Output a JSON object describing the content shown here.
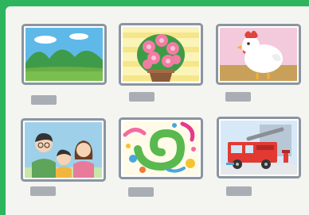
{
  "gallery": {
    "items": [
      {
        "icon": "mountain-landscape-icon",
        "label": ""
      },
      {
        "icon": "potted-flower-icon",
        "label": ""
      },
      {
        "icon": "chicken-icon",
        "label": ""
      },
      {
        "icon": "family-portrait-icon",
        "label": ""
      },
      {
        "icon": "abstract-swirl-icon",
        "label": ""
      },
      {
        "icon": "fire-truck-icon",
        "label": ""
      }
    ],
    "colors": {
      "background": "#2db55d",
      "wall": "#f4f4f1",
      "frame": "#8a95a0",
      "plate": "#a9aeb4"
    }
  }
}
